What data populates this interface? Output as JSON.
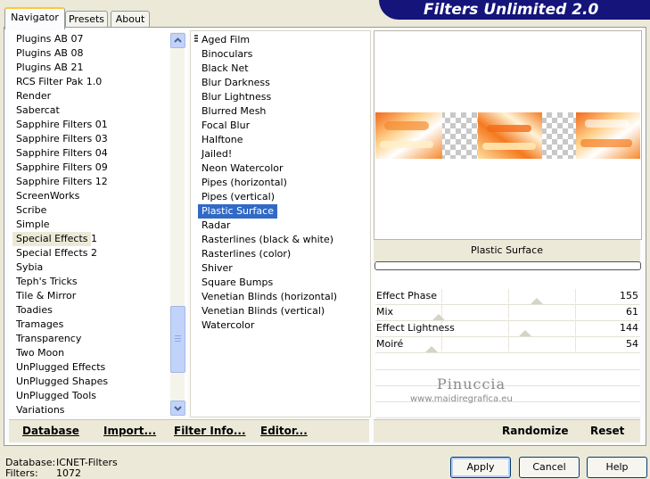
{
  "tabs": [
    {
      "label": "Navigator"
    },
    {
      "label": "Presets"
    },
    {
      "label": "About"
    }
  ],
  "title": "Filters Unlimited 2.0",
  "categories": [
    "Plugins AB 07",
    "Plugins AB 08",
    "Plugins AB 21",
    "RCS Filter Pak 1.0",
    "Render",
    "Sabercat",
    "Sapphire Filters 01",
    "Sapphire Filters 03",
    "Sapphire Filters 04",
    "Sapphire Filters 09",
    "Sapphire Filters 12",
    "ScreenWorks",
    "Scribe",
    "Simple",
    "Special Effects 1",
    "Special Effects 2",
    "Sybia",
    "Teph's Tricks",
    "Tile & Mirror",
    "Toadies",
    "Tramages",
    "Transparency",
    "Two Moon",
    "UnPlugged Effects",
    "UnPlugged Shapes",
    "UnPlugged Tools",
    "Variations"
  ],
  "selected_category": "Special Effects 1",
  "filters": [
    "Aged Film",
    "Binoculars",
    "Black Net",
    "Blur Darkness",
    "Blur Lightness",
    "Blurred Mesh",
    "Focal Blur",
    "Halftone",
    "Jailed!",
    "Neon Watercolor",
    "Pipes (horizontal)",
    "Pipes (vertical)",
    "Plastic Surface",
    "Radar",
    "Rasterlines (black & white)",
    "Rasterlines (color)",
    "Shiver",
    "Square Bumps",
    "Venetian Blinds (horizontal)",
    "Venetian Blinds (vertical)",
    "Watercolor"
  ],
  "selected_filter": "Plastic Surface",
  "preview": {
    "filter_name": "Plastic Surface"
  },
  "watermark": {
    "name": "Pinuccia",
    "url": "www.maidiregrafica.eu"
  },
  "params": [
    {
      "name": "Effect Phase",
      "value": "155",
      "level": 155
    },
    {
      "name": "Mix",
      "value": "61",
      "level": 61
    },
    {
      "name": "Effect Lightness",
      "value": "144",
      "level": 144
    },
    {
      "name": "Moiré",
      "value": "54",
      "level": 54
    }
  ],
  "toolbar": {
    "database": "Database",
    "import": "Import...",
    "filter_info": "Filter Info...",
    "editor": "Editor...",
    "randomize": "Randomize",
    "reset": "Reset"
  },
  "status": {
    "database_label": "Database:",
    "database_value": "ICNET-Filters",
    "filters_label": "Filters:",
    "filters_value": "1072"
  },
  "buttons": {
    "apply": "Apply",
    "cancel": "Cancel",
    "help": "Help"
  },
  "colors": {
    "banner": "#14147a",
    "selection": "#316ac5",
    "tab_highlight": "#ffc83c"
  }
}
